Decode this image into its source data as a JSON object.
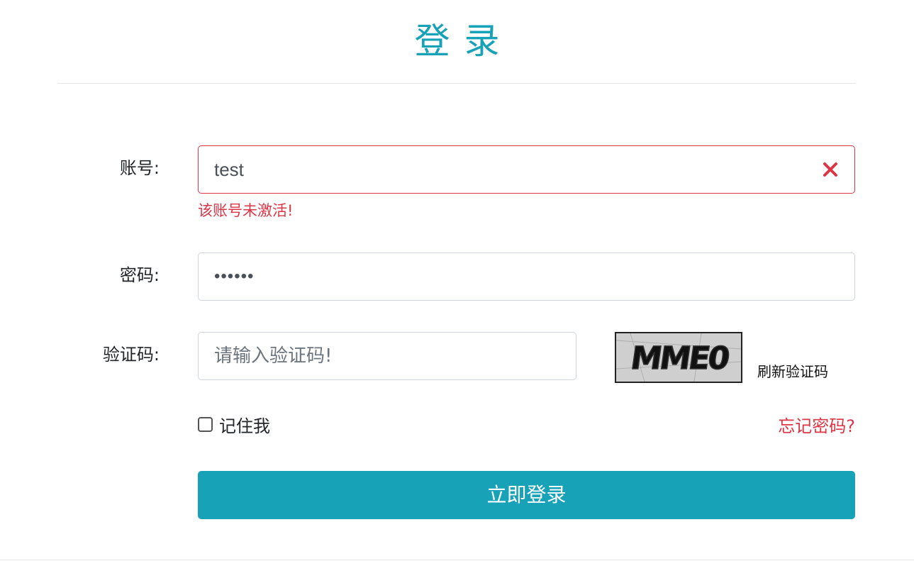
{
  "header": {
    "title": "登录"
  },
  "form": {
    "account": {
      "label": "账号:",
      "value": "test",
      "error": "该账号未激活!"
    },
    "password": {
      "label": "密码:",
      "value": "••••••"
    },
    "captcha": {
      "label": "验证码:",
      "placeholder": "请输入验证码!",
      "image_text": "MME0",
      "refresh_label": "刷新验证码"
    },
    "remember_label": "记住我",
    "remember_checked": false,
    "forgot_label": "忘记密码?",
    "submit_label": "立即登录"
  },
  "colors": {
    "primary": "#17a2b8",
    "danger": "#dc3545"
  }
}
